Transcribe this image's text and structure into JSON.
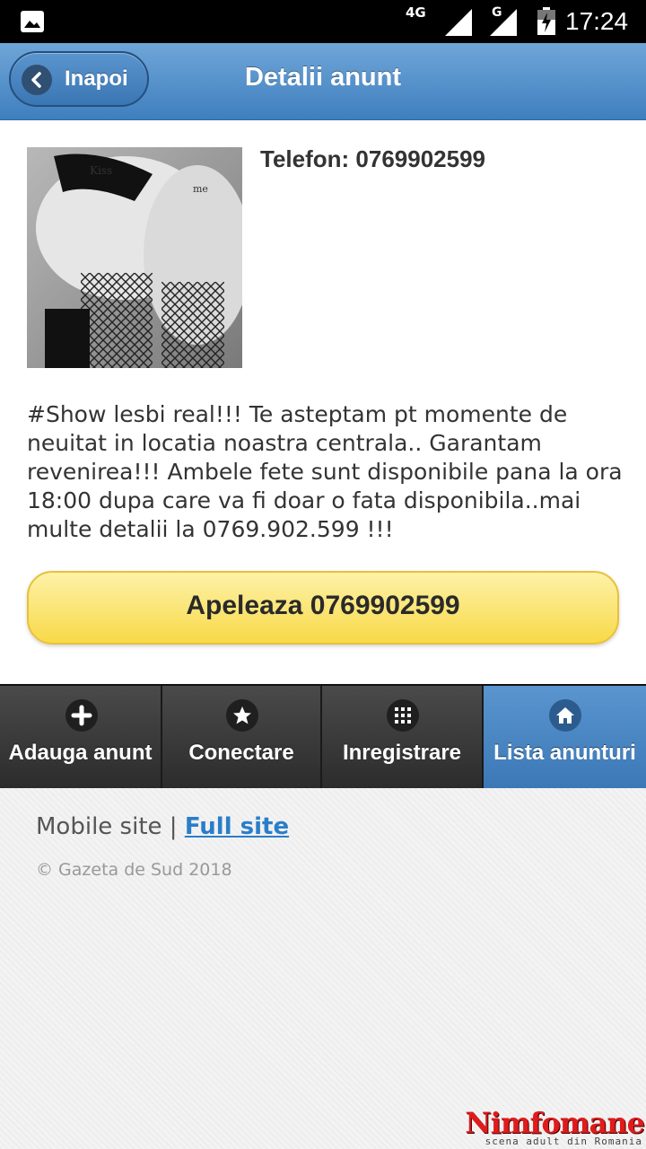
{
  "status_bar": {
    "network_1": "4G",
    "network_2": "G",
    "time": "17:24"
  },
  "header": {
    "back_label": "Inapoi",
    "title": "Detalii anunt"
  },
  "ad": {
    "phone_line": "Telefon: 0769902599",
    "description": "#Show lesbi real!!! Te asteptam pt momente de neuitat in locatia noastra centrala.. Garantam revenirea!!! Ambele fete sunt disponibile pana la ora 18:00 dupa care va fi doar o fata disponibila..mai multe detalii la 0769.902.599 !!!",
    "call_button": "Apeleaza 0769902599"
  },
  "navbar": {
    "items": [
      {
        "label": "Adauga anunt",
        "icon": "plus-icon"
      },
      {
        "label": "Conectare",
        "icon": "star-icon"
      },
      {
        "label": "Inregistrare",
        "icon": "grid-icon"
      },
      {
        "label": "Lista anunturi",
        "icon": "home-icon",
        "active": true
      }
    ]
  },
  "footer": {
    "mobile_text": "Mobile site | ",
    "full_site_link": "Full site",
    "copyright": "© Gazeta de Sud 2018"
  },
  "watermark": {
    "brand": "Nimfomane",
    "tagline": "scena adult din Romania"
  },
  "colors": {
    "header_blue": "#4f8ccb",
    "call_yellow": "#f8d948",
    "nav_dark": "#333333",
    "link_blue": "#2a7ec9",
    "watermark_red": "#e01b1b"
  }
}
